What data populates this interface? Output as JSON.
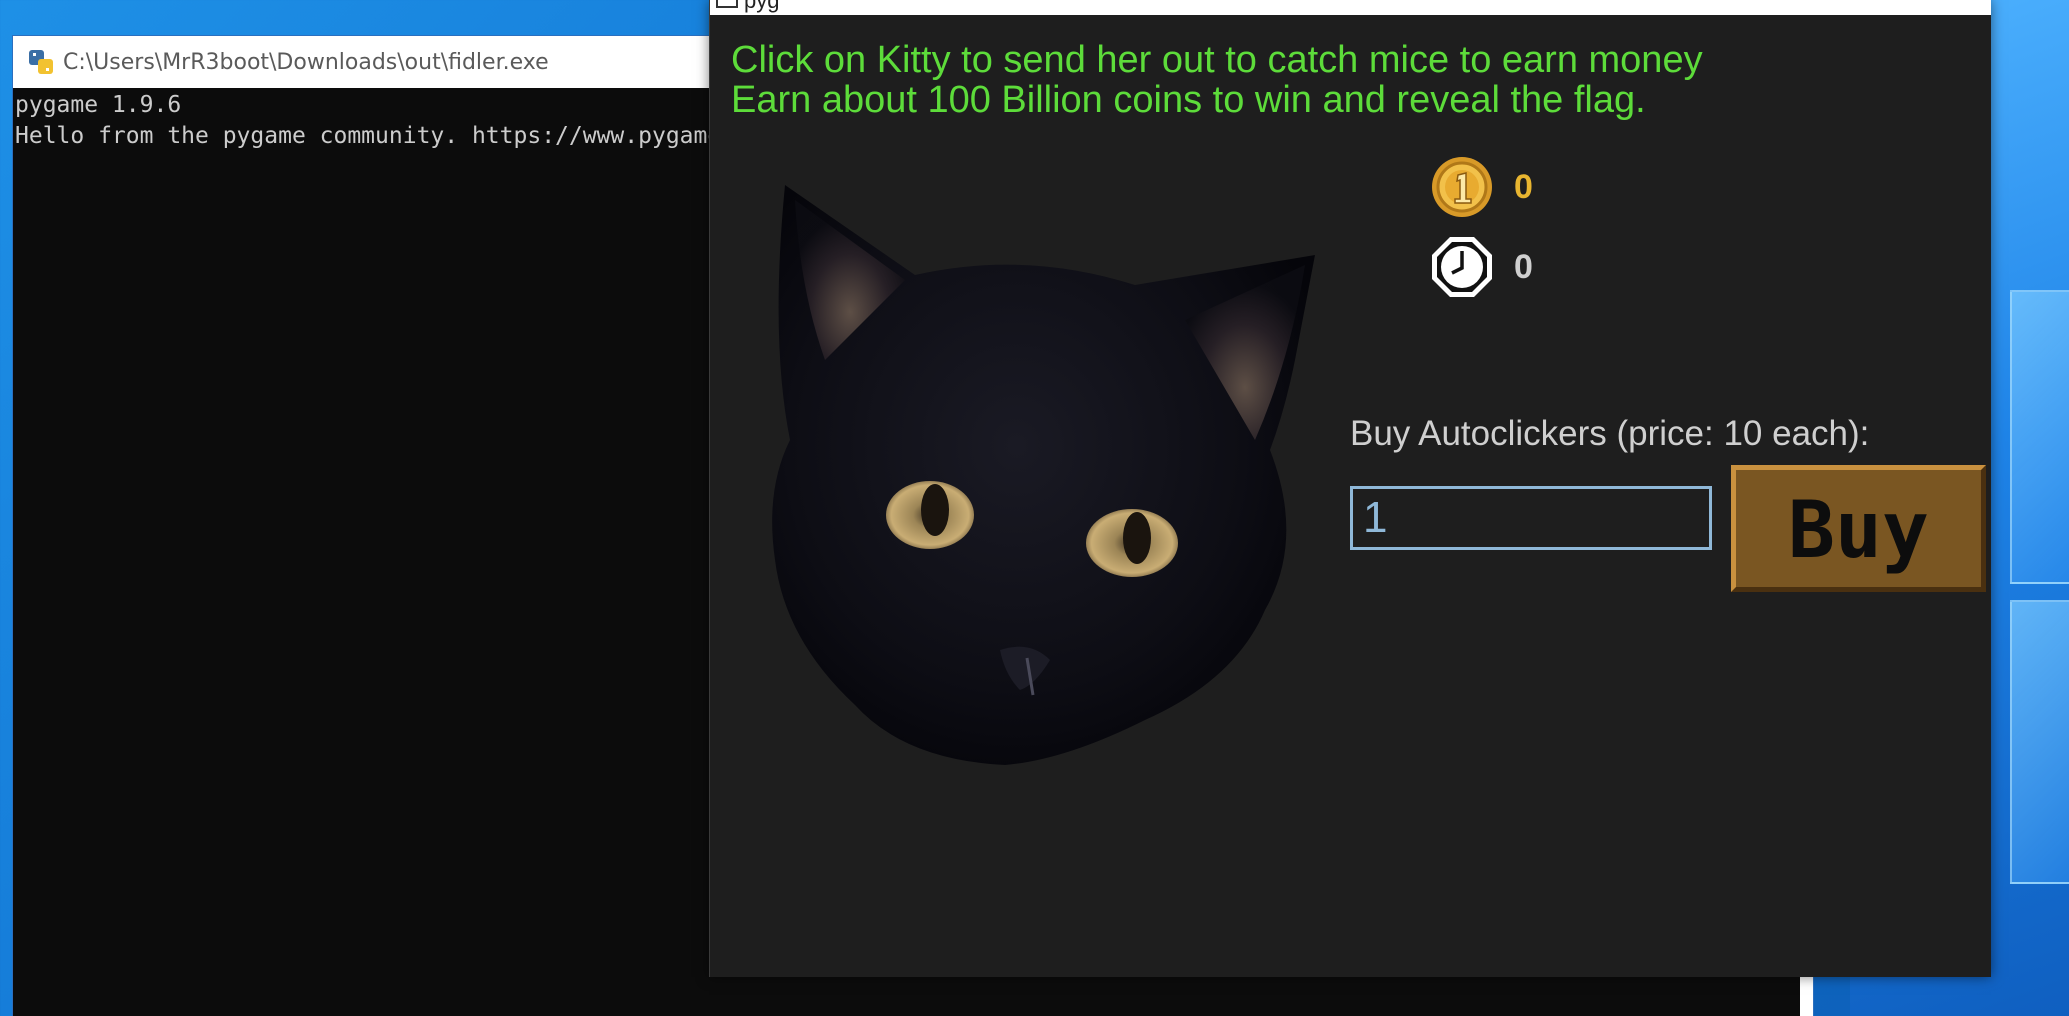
{
  "console": {
    "title": "C:\\Users\\MrR3boot\\Downloads\\out\\fidler.exe",
    "lines": [
      "pygame 1.9.6",
      "Hello from the pygame community. https://www.pygame.org/contribute.html"
    ]
  },
  "game": {
    "window_title": "pyg",
    "instructions": [
      "Click on Kitty to send her out to catch mice to earn money",
      "Earn about 100 Billion coins to win and reveal the flag."
    ],
    "coins": "0",
    "autoclickers": "0",
    "buy_label": "Buy Autoclickers (price: 10 each):",
    "quantity_value": "1",
    "buy_button_label": "Buy",
    "icons": {
      "coin": "coin-icon",
      "clock": "clock-icon",
      "kitty": "kitty-image"
    },
    "colors": {
      "instructions": "#5ddc3a",
      "coin_value": "#e8b530",
      "background": "#1e1e1e",
      "buy_button": "#7a5622"
    }
  }
}
